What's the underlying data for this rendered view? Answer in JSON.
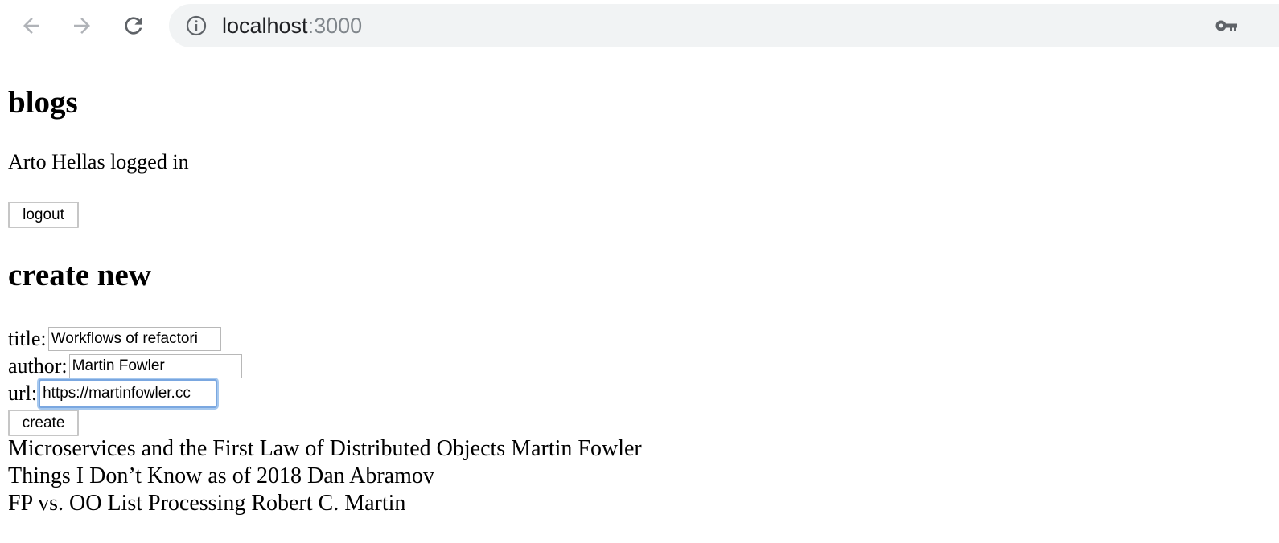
{
  "browser": {
    "url_host": "localhost",
    "url_port": ":3000",
    "icons": {
      "back": "arrow-left-icon",
      "forward": "arrow-right-icon",
      "reload": "reload-icon",
      "info": "info-icon",
      "key": "key-icon"
    }
  },
  "page": {
    "heading": "blogs",
    "logged_in_text": "Arto Hellas logged in",
    "logout_label": "logout",
    "create_heading": "create new",
    "form": {
      "title_label": "title:",
      "title_value": "Workflows of refactori",
      "author_label": "author:",
      "author_value": "Martin Fowler",
      "url_label": "url:",
      "url_value": "https://martinfowler.cc",
      "create_label": "create"
    },
    "blogs": [
      "Microservices and the First Law of Distributed Objects Martin Fowler",
      "Things I Don’t Know as of 2018 Dan Abramov",
      "FP vs. OO List Processing Robert C. Martin"
    ]
  },
  "colors": {
    "omnibox_bg": "#f1f3f4",
    "focus_ring": "#7aa7e0",
    "icon_gray": "#5f6368"
  }
}
